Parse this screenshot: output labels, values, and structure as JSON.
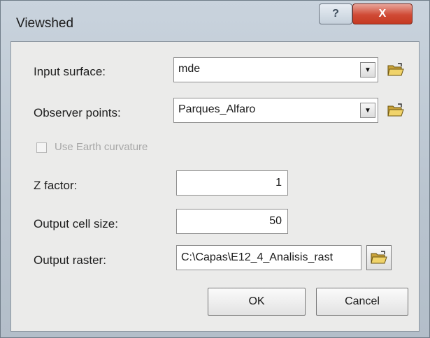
{
  "window": {
    "title": "Viewshed",
    "help_glyph": "?",
    "close_glyph": "X"
  },
  "fields": {
    "input_surface": {
      "label": "Input surface:",
      "value": "mde",
      "icon": "folder-open-icon"
    },
    "observer_points": {
      "label": "Observer points:",
      "value": "Parques_Alfaro",
      "icon": "folder-open-icon"
    },
    "earth_curvature": {
      "label": "Use Earth curvature",
      "checked": false,
      "enabled": false
    },
    "z_factor": {
      "label": "Z factor:",
      "value": "1"
    },
    "output_cell_size": {
      "label": "Output cell size:",
      "value": "50"
    },
    "output_raster": {
      "label": "Output raster:",
      "value": "C:\\Capas\\E12_4_Analisis_rast",
      "icon": "folder-open-icon"
    }
  },
  "buttons": {
    "ok": "OK",
    "cancel": "Cancel"
  },
  "colors": {
    "close_red": "#c53a22",
    "disabled_text": "#a7a7a7"
  }
}
